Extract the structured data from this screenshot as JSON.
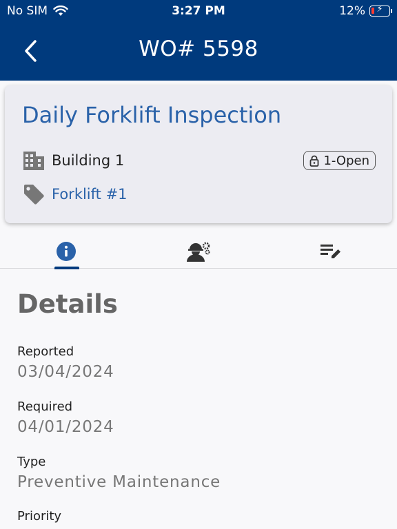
{
  "status_bar": {
    "carrier": "No SIM",
    "time": "3:27 PM",
    "battery": "12%",
    "battery_color": "#ff3b30"
  },
  "header": {
    "title": "WO# 5598",
    "back_icon": "chevron-left-icon",
    "background": "#003a7d"
  },
  "card": {
    "title": "Daily Forklift Inspection",
    "building": "Building 1",
    "building_icon": "building-icon",
    "status": "1-Open",
    "status_icon": "lock-icon",
    "asset": "Forklift #1",
    "asset_icon": "tag-icon",
    "accent": "#2a62a9"
  },
  "tabs": [
    {
      "name": "details",
      "icon": "info-icon",
      "active": true
    },
    {
      "name": "labor",
      "icon": "worker-gear-icon",
      "active": false
    },
    {
      "name": "notes",
      "icon": "edit-list-icon",
      "active": false
    }
  ],
  "details": {
    "title": "Details",
    "fields": [
      {
        "label": "Reported",
        "value": "03/04/2024"
      },
      {
        "label": "Required",
        "value": "04/01/2024"
      },
      {
        "label": "Type",
        "value": "Preventive Maintenance"
      },
      {
        "label": "Priority",
        "value": ""
      }
    ]
  }
}
